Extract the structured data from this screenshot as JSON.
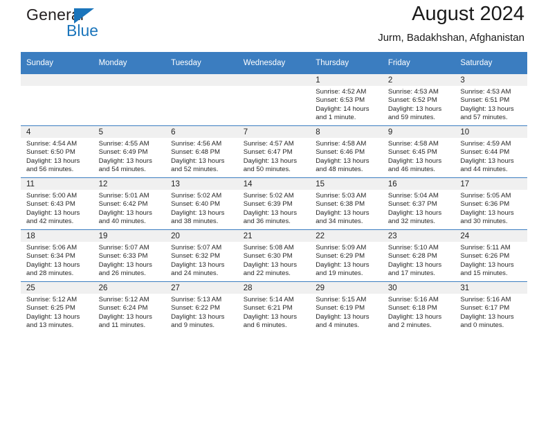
{
  "logo": {
    "word_general": "General",
    "word_blue": "Blue",
    "triangle_color": "#1b75bb"
  },
  "header": {
    "title": "August 2024",
    "subtitle": "Jurm, Badakhshan, Afghanistan"
  },
  "colors": {
    "header_blue": "#3b7dc0",
    "daynum_gray": "#f0f0f0",
    "text": "#262626"
  },
  "calendar": {
    "weekday_headers": [
      "Sunday",
      "Monday",
      "Tuesday",
      "Wednesday",
      "Thursday",
      "Friday",
      "Saturday"
    ],
    "weeks": [
      [
        {
          "day": "",
          "empty": true
        },
        {
          "day": "",
          "empty": true
        },
        {
          "day": "",
          "empty": true
        },
        {
          "day": "",
          "empty": true
        },
        {
          "day": "1",
          "sunrise": "Sunrise: 4:52 AM",
          "sunset": "Sunset: 6:53 PM",
          "daylight_1": "Daylight: 14 hours",
          "daylight_2": "and 1 minute."
        },
        {
          "day": "2",
          "sunrise": "Sunrise: 4:53 AM",
          "sunset": "Sunset: 6:52 PM",
          "daylight_1": "Daylight: 13 hours",
          "daylight_2": "and 59 minutes."
        },
        {
          "day": "3",
          "sunrise": "Sunrise: 4:53 AM",
          "sunset": "Sunset: 6:51 PM",
          "daylight_1": "Daylight: 13 hours",
          "daylight_2": "and 57 minutes."
        }
      ],
      [
        {
          "day": "4",
          "sunrise": "Sunrise: 4:54 AM",
          "sunset": "Sunset: 6:50 PM",
          "daylight_1": "Daylight: 13 hours",
          "daylight_2": "and 56 minutes."
        },
        {
          "day": "5",
          "sunrise": "Sunrise: 4:55 AM",
          "sunset": "Sunset: 6:49 PM",
          "daylight_1": "Daylight: 13 hours",
          "daylight_2": "and 54 minutes."
        },
        {
          "day": "6",
          "sunrise": "Sunrise: 4:56 AM",
          "sunset": "Sunset: 6:48 PM",
          "daylight_1": "Daylight: 13 hours",
          "daylight_2": "and 52 minutes."
        },
        {
          "day": "7",
          "sunrise": "Sunrise: 4:57 AM",
          "sunset": "Sunset: 6:47 PM",
          "daylight_1": "Daylight: 13 hours",
          "daylight_2": "and 50 minutes."
        },
        {
          "day": "8",
          "sunrise": "Sunrise: 4:58 AM",
          "sunset": "Sunset: 6:46 PM",
          "daylight_1": "Daylight: 13 hours",
          "daylight_2": "and 48 minutes."
        },
        {
          "day": "9",
          "sunrise": "Sunrise: 4:58 AM",
          "sunset": "Sunset: 6:45 PM",
          "daylight_1": "Daylight: 13 hours",
          "daylight_2": "and 46 minutes."
        },
        {
          "day": "10",
          "sunrise": "Sunrise: 4:59 AM",
          "sunset": "Sunset: 6:44 PM",
          "daylight_1": "Daylight: 13 hours",
          "daylight_2": "and 44 minutes."
        }
      ],
      [
        {
          "day": "11",
          "sunrise": "Sunrise: 5:00 AM",
          "sunset": "Sunset: 6:43 PM",
          "daylight_1": "Daylight: 13 hours",
          "daylight_2": "and 42 minutes."
        },
        {
          "day": "12",
          "sunrise": "Sunrise: 5:01 AM",
          "sunset": "Sunset: 6:42 PM",
          "daylight_1": "Daylight: 13 hours",
          "daylight_2": "and 40 minutes."
        },
        {
          "day": "13",
          "sunrise": "Sunrise: 5:02 AM",
          "sunset": "Sunset: 6:40 PM",
          "daylight_1": "Daylight: 13 hours",
          "daylight_2": "and 38 minutes."
        },
        {
          "day": "14",
          "sunrise": "Sunrise: 5:02 AM",
          "sunset": "Sunset: 6:39 PM",
          "daylight_1": "Daylight: 13 hours",
          "daylight_2": "and 36 minutes."
        },
        {
          "day": "15",
          "sunrise": "Sunrise: 5:03 AM",
          "sunset": "Sunset: 6:38 PM",
          "daylight_1": "Daylight: 13 hours",
          "daylight_2": "and 34 minutes."
        },
        {
          "day": "16",
          "sunrise": "Sunrise: 5:04 AM",
          "sunset": "Sunset: 6:37 PM",
          "daylight_1": "Daylight: 13 hours",
          "daylight_2": "and 32 minutes."
        },
        {
          "day": "17",
          "sunrise": "Sunrise: 5:05 AM",
          "sunset": "Sunset: 6:36 PM",
          "daylight_1": "Daylight: 13 hours",
          "daylight_2": "and 30 minutes."
        }
      ],
      [
        {
          "day": "18",
          "sunrise": "Sunrise: 5:06 AM",
          "sunset": "Sunset: 6:34 PM",
          "daylight_1": "Daylight: 13 hours",
          "daylight_2": "and 28 minutes."
        },
        {
          "day": "19",
          "sunrise": "Sunrise: 5:07 AM",
          "sunset": "Sunset: 6:33 PM",
          "daylight_1": "Daylight: 13 hours",
          "daylight_2": "and 26 minutes."
        },
        {
          "day": "20",
          "sunrise": "Sunrise: 5:07 AM",
          "sunset": "Sunset: 6:32 PM",
          "daylight_1": "Daylight: 13 hours",
          "daylight_2": "and 24 minutes."
        },
        {
          "day": "21",
          "sunrise": "Sunrise: 5:08 AM",
          "sunset": "Sunset: 6:30 PM",
          "daylight_1": "Daylight: 13 hours",
          "daylight_2": "and 22 minutes."
        },
        {
          "day": "22",
          "sunrise": "Sunrise: 5:09 AM",
          "sunset": "Sunset: 6:29 PM",
          "daylight_1": "Daylight: 13 hours",
          "daylight_2": "and 19 minutes."
        },
        {
          "day": "23",
          "sunrise": "Sunrise: 5:10 AM",
          "sunset": "Sunset: 6:28 PM",
          "daylight_1": "Daylight: 13 hours",
          "daylight_2": "and 17 minutes."
        },
        {
          "day": "24",
          "sunrise": "Sunrise: 5:11 AM",
          "sunset": "Sunset: 6:26 PM",
          "daylight_1": "Daylight: 13 hours",
          "daylight_2": "and 15 minutes."
        }
      ],
      [
        {
          "day": "25",
          "sunrise": "Sunrise: 5:12 AM",
          "sunset": "Sunset: 6:25 PM",
          "daylight_1": "Daylight: 13 hours",
          "daylight_2": "and 13 minutes."
        },
        {
          "day": "26",
          "sunrise": "Sunrise: 5:12 AM",
          "sunset": "Sunset: 6:24 PM",
          "daylight_1": "Daylight: 13 hours",
          "daylight_2": "and 11 minutes."
        },
        {
          "day": "27",
          "sunrise": "Sunrise: 5:13 AM",
          "sunset": "Sunset: 6:22 PM",
          "daylight_1": "Daylight: 13 hours",
          "daylight_2": "and 9 minutes."
        },
        {
          "day": "28",
          "sunrise": "Sunrise: 5:14 AM",
          "sunset": "Sunset: 6:21 PM",
          "daylight_1": "Daylight: 13 hours",
          "daylight_2": "and 6 minutes."
        },
        {
          "day": "29",
          "sunrise": "Sunrise: 5:15 AM",
          "sunset": "Sunset: 6:19 PM",
          "daylight_1": "Daylight: 13 hours",
          "daylight_2": "and 4 minutes."
        },
        {
          "day": "30",
          "sunrise": "Sunrise: 5:16 AM",
          "sunset": "Sunset: 6:18 PM",
          "daylight_1": "Daylight: 13 hours",
          "daylight_2": "and 2 minutes."
        },
        {
          "day": "31",
          "sunrise": "Sunrise: 5:16 AM",
          "sunset": "Sunset: 6:17 PM",
          "daylight_1": "Daylight: 13 hours",
          "daylight_2": "and 0 minutes."
        }
      ]
    ]
  }
}
